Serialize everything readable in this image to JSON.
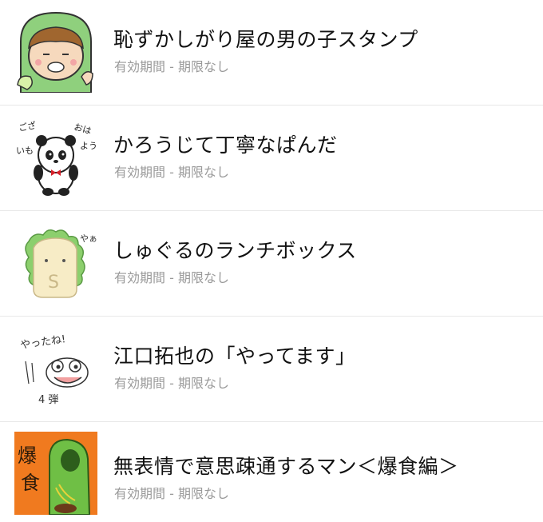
{
  "items": [
    {
      "icon": "shy-boy-green-hood-sticker-icon",
      "title": "恥ずかしがり屋の男の子スタンプ",
      "validity": "有効期間 - 期限なし",
      "thumb_text": ""
    },
    {
      "icon": "panda-bowtie-sticker-icon",
      "title": "かろうじて丁寧なぱんだ",
      "validity": "有効期間 - 期限なし",
      "thumb_text": "おはようございもん"
    },
    {
      "icon": "sandwich-mascot-sticker-icon",
      "title": "しゅぐるのランチボックス",
      "validity": "有効期間 - 期限なし",
      "thumb_text": "やぁ"
    },
    {
      "icon": "frog-doodle-sticker-icon",
      "title": "江口拓也の「やってます」",
      "validity": "有効期間 - 期限なし",
      "thumb_text": "やったね! 4弾"
    },
    {
      "icon": "green-hooded-man-sticker-icon",
      "title": "無表情で意思疎通するマン＜爆食編＞",
      "validity": "有効期間 - 期限なし",
      "thumb_text": "爆食"
    }
  ],
  "colors": {
    "title": "#111111",
    "subtitle": "#9a9a9a",
    "divider": "#e8e8e8",
    "green": "#7cc576",
    "orange": "#f07a1f"
  }
}
